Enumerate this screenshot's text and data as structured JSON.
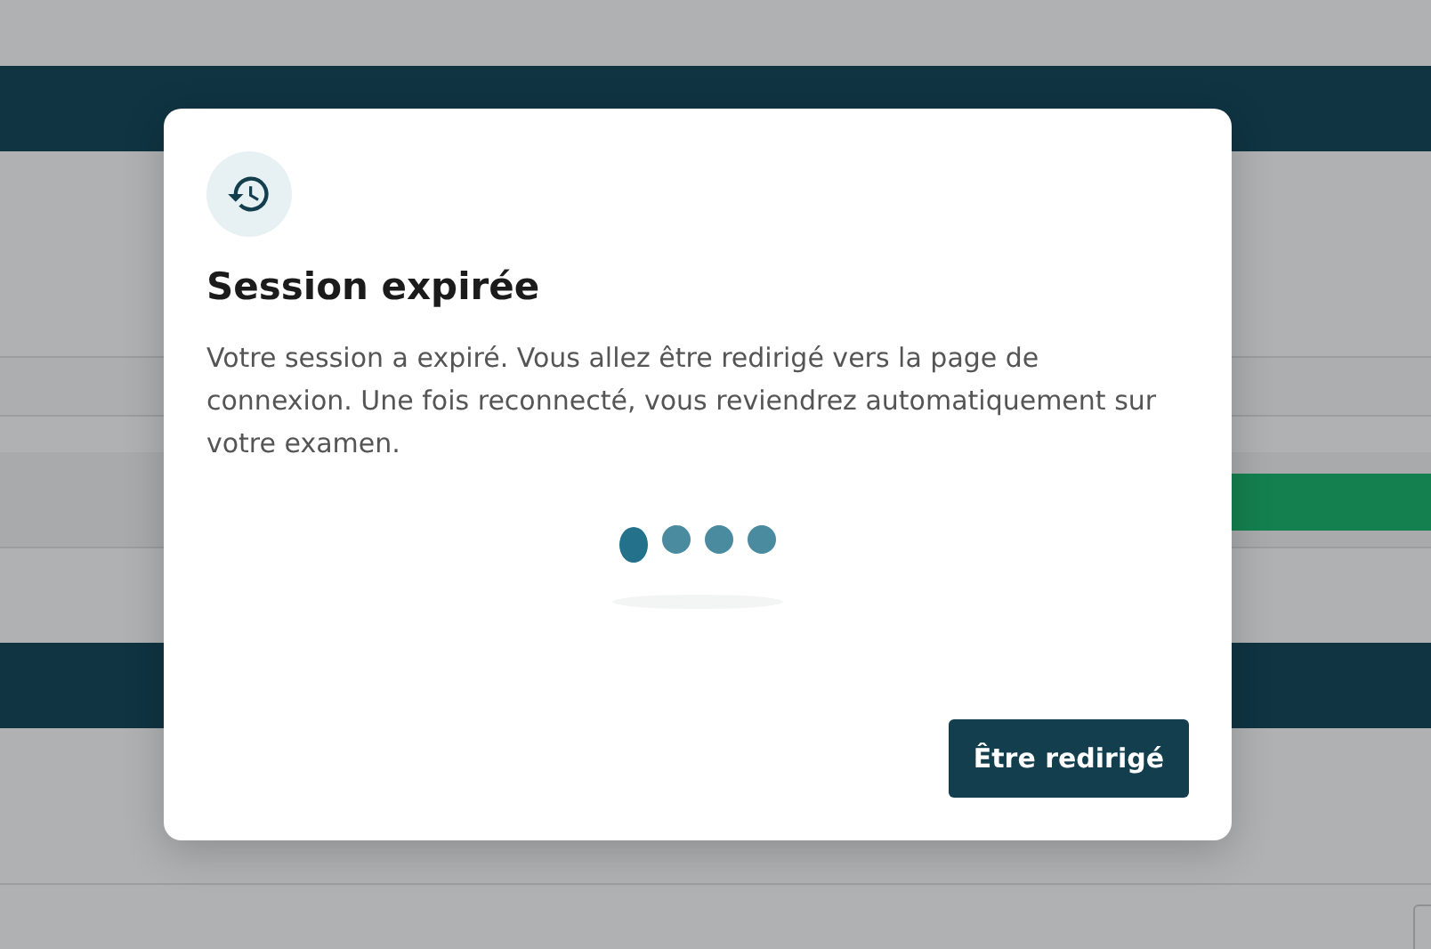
{
  "dialog": {
    "title": "Session expirée",
    "message": "Votre session a expiré. Vous allez être redirigé vers la page de connexion. Une fois reconnecté, vous reviendrez automatiquement sur votre examen.",
    "button": "Être redirigé"
  }
}
